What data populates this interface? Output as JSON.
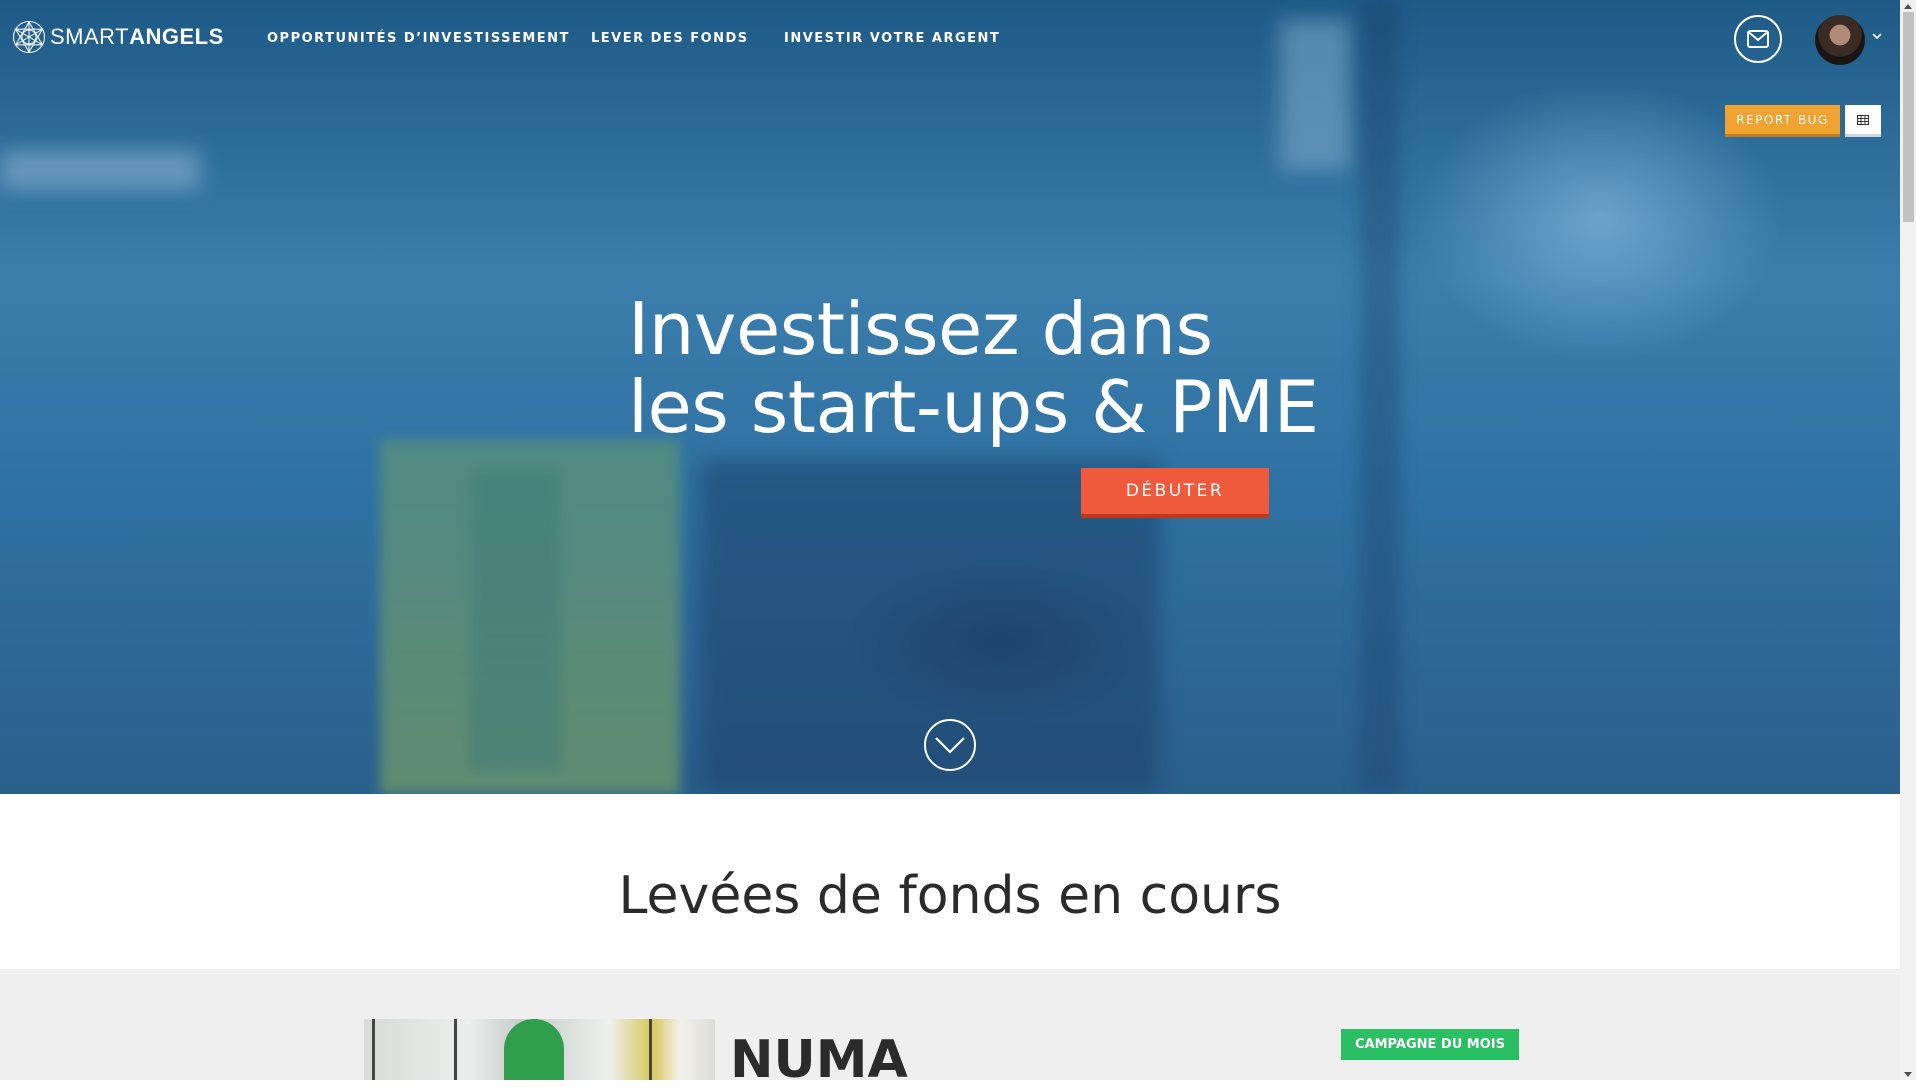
{
  "brand": {
    "logo_icon": "sacred-geometry-logo-icon",
    "name_light": "SMART",
    "name_bold": "ANGELS"
  },
  "nav": {
    "items": [
      {
        "label": "OPPORTUNITÉS D’INVESTISSEMENT"
      },
      {
        "label": "LEVER DES FONDS"
      },
      {
        "label": "INVESTIR VOTRE ARGENT"
      }
    ],
    "mail_icon": "envelope-icon",
    "user_menu_icon": "chevron-down-icon"
  },
  "tools": {
    "report_bug_label": "REPORT BUG",
    "grid_icon": "grid-icon"
  },
  "hero": {
    "title_line1": "Investissez dans",
    "title_line2": "les start-ups & PME",
    "cta_label": "DÉBUTER",
    "scroll_icon": "chevron-down-circle-icon"
  },
  "section": {
    "title": "Levées de fonds en cours"
  },
  "campaign": {
    "name": "NUMA",
    "badge": "CAMPAGNE DU MOIS"
  },
  "colors": {
    "hero_overlay": "#2f72a4",
    "cta": "#f05a3c",
    "report_bug": "#f0a330",
    "badge": "#2bbf63"
  }
}
